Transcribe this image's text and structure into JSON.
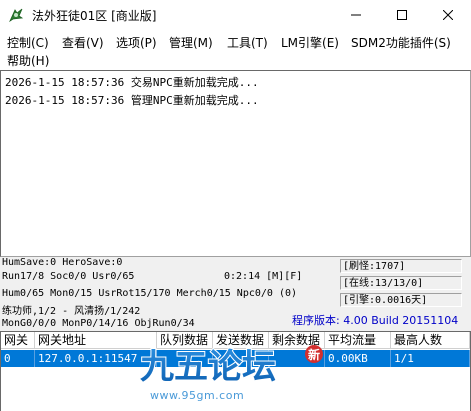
{
  "window": {
    "title": "法外狂徒01区 [商业版]"
  },
  "menu": {
    "items": [
      {
        "label": "控制(C)"
      },
      {
        "label": "查看(V)"
      },
      {
        "label": "选项(P)"
      },
      {
        "label": "管理(M)"
      },
      {
        "label": "工具(T)"
      },
      {
        "label": "LM引擎(E)"
      },
      {
        "label": "SDM2功能插件(S)"
      },
      {
        "label": "帮助(H)"
      }
    ]
  },
  "log": {
    "lines": [
      "2026-1-15 18:57:36 交易NPC重新加载完成...",
      "2026-1-15 18:57:36 管理NPC重新加载完成..."
    ]
  },
  "stats": {
    "line1": "HumSave:0 HeroSave:0",
    "line2": "Run17/8 Soc0/0 Usr0/65",
    "timer": "0:2:14 [M][F]",
    "line3": "Hum0/65 Mon0/15 UsrRot15/170 Merch0/15 Npc0/0 (0)",
    "line4": "练功师,1/2 - 风清扬/1/242",
    "line5": "MonG0/0/0 MonP0/14/16 ObjRun0/34",
    "box_monsters": "[刷怪:1707]",
    "box_online": "[在线:13/13/0]",
    "box_engine": "[引擎:0.0016天]",
    "version": "程序版本: 4.00 Build 20151104"
  },
  "gate_table": {
    "columns": [
      "网关",
      "网关地址",
      "队列数据",
      "发送数据",
      "剩余数据",
      "平均流量",
      "最高人数"
    ],
    "rows": [
      [
        "0",
        "127.0.0.1:11547",
        "",
        "",
        "",
        "0.00KB",
        "1/1"
      ]
    ]
  },
  "watermark": {
    "logo_text": "九五论坛",
    "badge": "新",
    "url": "www.95gm.com"
  },
  "colors": {
    "selection": "#0078d7",
    "version_text": "#0000c8",
    "watermark": "#1a7fd4"
  }
}
